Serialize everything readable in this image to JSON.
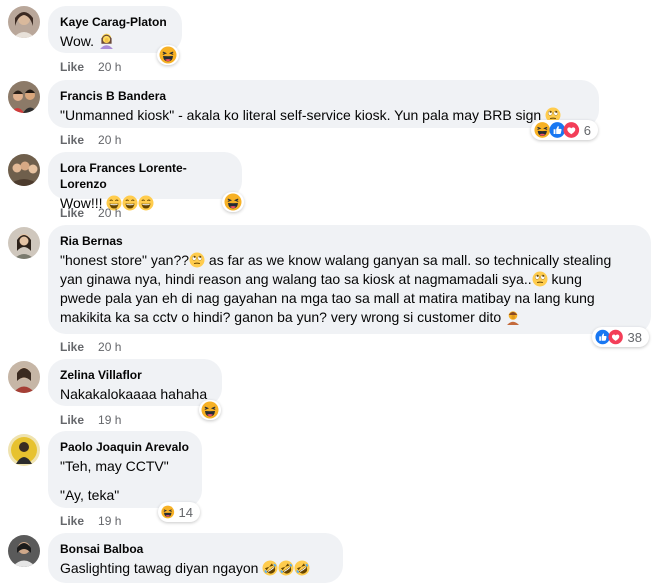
{
  "comments": [
    {
      "author": "Kaye Carag-Platon",
      "text": [
        "Wow."
      ],
      "emoji_icons": [
        "woman-facepalming-icon"
      ],
      "like_label": "Like",
      "time": "20 h",
      "reactions": [
        "haha-reaction-icon"
      ],
      "reaction_count": ""
    },
    {
      "author": "Francis B Bandera",
      "text": [
        "\"Unmanned kiosk\" - akala ko literal self-service kiosk. Yun pala may BRB sign"
      ],
      "emoji_icons": [
        "eye-roll-emoji-icon"
      ],
      "like_label": "Like",
      "time": "20 h",
      "reactions": [
        "haha-reaction-icon",
        "like-reaction-icon",
        "love-reaction-icon"
      ],
      "reaction_count": "6"
    },
    {
      "author": "Lora Frances Lorente-Lorenzo",
      "text": [
        "Wow!!!"
      ],
      "emoji_icons": [
        "laughing-emoji-icon",
        "laughing-emoji-icon",
        "laughing-emoji-icon"
      ],
      "like_label": "Like",
      "time": "20 h",
      "reactions": [
        "haha-reaction-icon"
      ],
      "reaction_count": ""
    },
    {
      "author": "Ria Bernas",
      "text": [
        "\"honest store\" yan??",
        " as far as we know walang ganyan sa mall. so technically stealing",
        "yan ginawa nya, hindi reason ang walang tao sa kiosk at nagmamadali sya..",
        " kung",
        "pwede pala yan eh di nag gayahan na mga tao sa mall at matira matibay na lang kung",
        "makikita ka sa cctv o hindi? ganon ba yun? very wrong si customer dito"
      ],
      "emoji_icons": [
        "eye-roll-emoji-icon",
        "eye-roll-emoji-icon",
        "person-facepalming-icon"
      ],
      "like_label": "Like",
      "time": "20 h",
      "reactions": [
        "like-reaction-icon",
        "love-reaction-icon"
      ],
      "reaction_count": "38"
    },
    {
      "author": "Zelina Villaflor",
      "text": [
        "Nakakalokaaaa hahaha"
      ],
      "emoji_icons": [],
      "like_label": "Like",
      "time": "19 h",
      "reactions": [
        "haha-reaction-icon"
      ],
      "reaction_count": ""
    },
    {
      "author": "Paolo Joaquin Arevalo",
      "text": [
        "\"Teh, may CCTV\"",
        "\"Ay, teka\""
      ],
      "emoji_icons": [],
      "like_label": "Like",
      "time": "19 h",
      "reactions": [
        "haha-reaction-icon"
      ],
      "reaction_count": "14"
    },
    {
      "author": "Bonsai Balboa",
      "text": [
        "Gaslighting tawag diyan ngayon"
      ],
      "emoji_icons": [
        "rofl-emoji-icon",
        "rofl-emoji-icon",
        "rofl-emoji-icon"
      ],
      "like_label": "",
      "time": "",
      "reactions": [],
      "reaction_count": ""
    }
  ],
  "colors": {
    "bubble": "#f0f2f5",
    "meta_text": "#65676b",
    "like_blue": "#1877f2",
    "love_red": "#f33e58",
    "haha_yellow": "#f7b125"
  }
}
